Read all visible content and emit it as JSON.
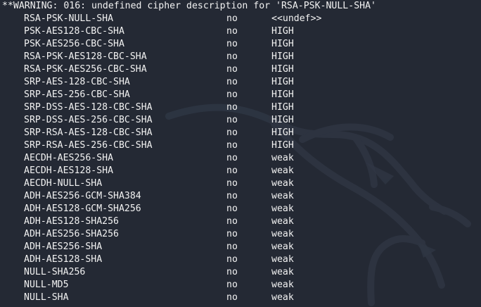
{
  "warning": "**WARNING: 016: undefined cipher description for 'RSA-PSK-NULL-SHA'",
  "rows": [
    {
      "name": "RSA-PSK-NULL-SHA",
      "auth": "no",
      "strength": "<<undef>>"
    },
    {
      "name": "PSK-AES128-CBC-SHA",
      "auth": "no",
      "strength": "HIGH"
    },
    {
      "name": "PSK-AES256-CBC-SHA",
      "auth": "no",
      "strength": "HIGH"
    },
    {
      "name": "RSA-PSK-AES128-CBC-SHA",
      "auth": "no",
      "strength": "HIGH"
    },
    {
      "name": "RSA-PSK-AES256-CBC-SHA",
      "auth": "no",
      "strength": "HIGH"
    },
    {
      "name": "SRP-AES-128-CBC-SHA",
      "auth": "no",
      "strength": "HIGH"
    },
    {
      "name": "SRP-AES-256-CBC-SHA",
      "auth": "no",
      "strength": "HIGH"
    },
    {
      "name": "SRP-DSS-AES-128-CBC-SHA",
      "auth": "no",
      "strength": "HIGH"
    },
    {
      "name": "SRP-DSS-AES-256-CBC-SHA",
      "auth": "no",
      "strength": "HIGH"
    },
    {
      "name": "SRP-RSA-AES-128-CBC-SHA",
      "auth": "no",
      "strength": "HIGH"
    },
    {
      "name": "SRP-RSA-AES-256-CBC-SHA",
      "auth": "no",
      "strength": "HIGH"
    },
    {
      "name": "AECDH-AES256-SHA",
      "auth": "no",
      "strength": "weak"
    },
    {
      "name": "AECDH-AES128-SHA",
      "auth": "no",
      "strength": "weak"
    },
    {
      "name": "AECDH-NULL-SHA",
      "auth": "no",
      "strength": "weak"
    },
    {
      "name": "ADH-AES256-GCM-SHA384",
      "auth": "no",
      "strength": "weak"
    },
    {
      "name": "ADH-AES128-GCM-SHA256",
      "auth": "no",
      "strength": "weak"
    },
    {
      "name": "ADH-AES128-SHA256",
      "auth": "no",
      "strength": "weak"
    },
    {
      "name": "ADH-AES256-SHA256",
      "auth": "no",
      "strength": "weak"
    },
    {
      "name": "ADH-AES256-SHA",
      "auth": "no",
      "strength": "weak"
    },
    {
      "name": "ADH-AES128-SHA",
      "auth": "no",
      "strength": "weak"
    },
    {
      "name": "NULL-SHA256",
      "auth": "no",
      "strength": "weak"
    },
    {
      "name": "NULL-MD5",
      "auth": "no",
      "strength": "weak"
    },
    {
      "name": "NULL-SHA",
      "auth": "no",
      "strength": "weak"
    }
  ],
  "colors": {
    "background": "#242934",
    "text": "#f2f2f2",
    "watermark": "#2f3643"
  },
  "icons": {
    "watermark": "kali-dragon-watermark"
  }
}
